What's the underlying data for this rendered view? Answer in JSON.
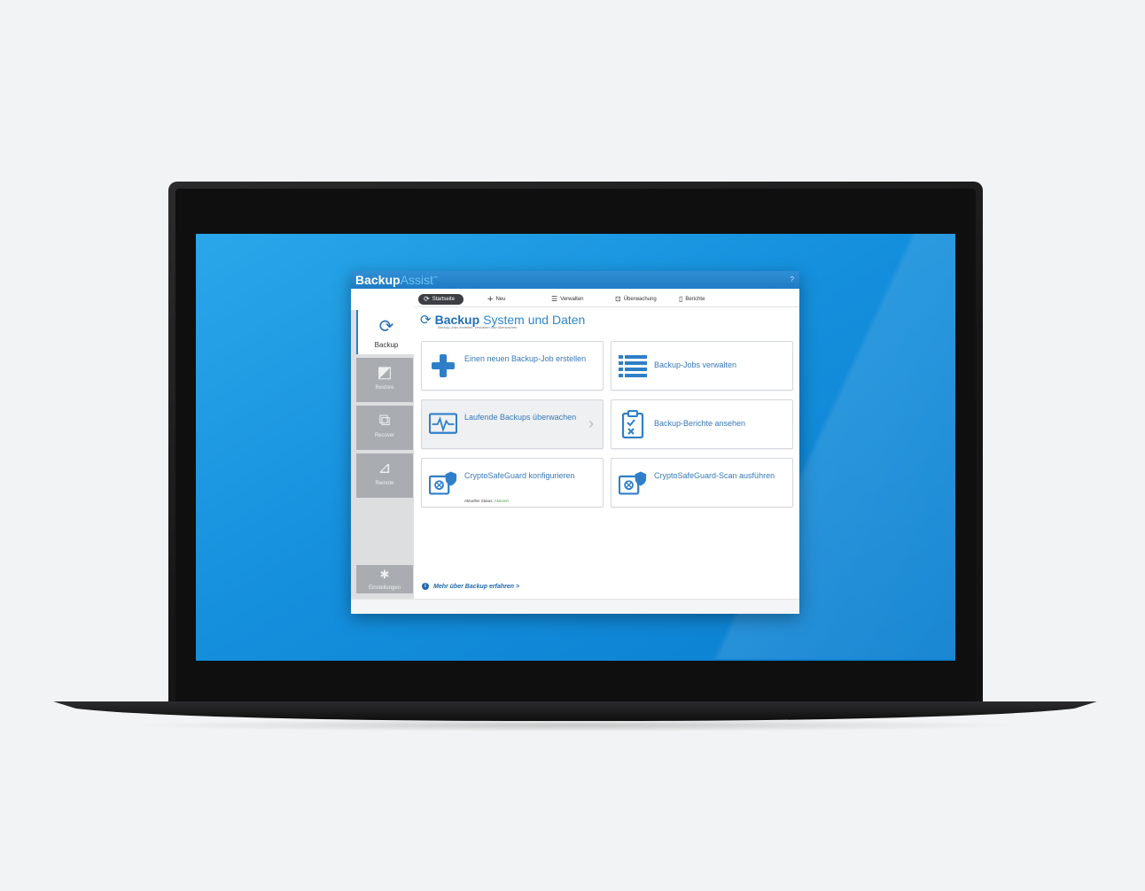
{
  "app": {
    "logo_primary": "Backup",
    "logo_secondary": "Assist",
    "logo_mark": "™",
    "help_label": "?"
  },
  "toolbar": {
    "items": [
      {
        "label": "Startseite",
        "icon": "refresh-icon",
        "active": true
      },
      {
        "label": "Neu",
        "icon": "plus-icon"
      },
      {
        "label": "Verwalten",
        "icon": "list-icon"
      },
      {
        "label": "Überwachung",
        "icon": "monitor-icon"
      },
      {
        "label": "Berichte",
        "icon": "clipboard-icon"
      }
    ]
  },
  "sidebar": {
    "items": [
      {
        "label": "Backup",
        "icon": "backup-refresh-icon",
        "active": true
      },
      {
        "label": "Restore",
        "icon": "restore-icon"
      },
      {
        "label": "Recover",
        "icon": "recover-icon"
      },
      {
        "label": "Remote",
        "icon": "remote-icon"
      }
    ],
    "settings_label": "Einstellungen"
  },
  "main": {
    "title_bold": "Backup",
    "title_light": "System und Daten",
    "subtitle": "Backup-Jobs erstellen, verwalten und überwachen",
    "cards": [
      {
        "text": "Einen neuen Backup-Job erstellen",
        "icon": "big-plus-icon"
      },
      {
        "text": "Backup-Jobs verwalten",
        "icon": "list-icon"
      },
      {
        "text": "Laufende Backups überwachen",
        "icon": "pulse-monitor-icon"
      },
      {
        "text": "Backup-Berichte ansehen",
        "icon": "report-checklist-icon"
      },
      {
        "text": "CryptoSafeGuard konfigurieren",
        "icon": "safe-shield-icon",
        "status_label": "Aktueller Status:",
        "status_value": "Aktiviert"
      },
      {
        "text": "CryptoSafeGuard-Scan ausführen",
        "icon": "safe-shield-scan-icon"
      }
    ],
    "more_link": "Mehr über Backup erfahren >"
  },
  "colors": {
    "accent": "#1f7cc4",
    "screen": "#1590dd",
    "status_ok": "#4aa64a"
  }
}
